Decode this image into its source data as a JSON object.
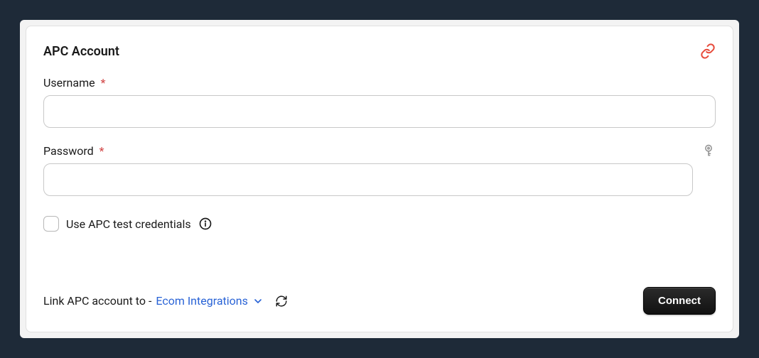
{
  "header": {
    "title": "APC Account"
  },
  "fields": {
    "username": {
      "label": "Username",
      "required": "*",
      "value": ""
    },
    "password": {
      "label": "Password",
      "required": "*",
      "value": ""
    }
  },
  "checkbox": {
    "label": "Use APC test credentials"
  },
  "footer": {
    "link_prefix": "Link APC account to -",
    "account_name": "Ecom Integrations",
    "connect_label": "Connect"
  }
}
